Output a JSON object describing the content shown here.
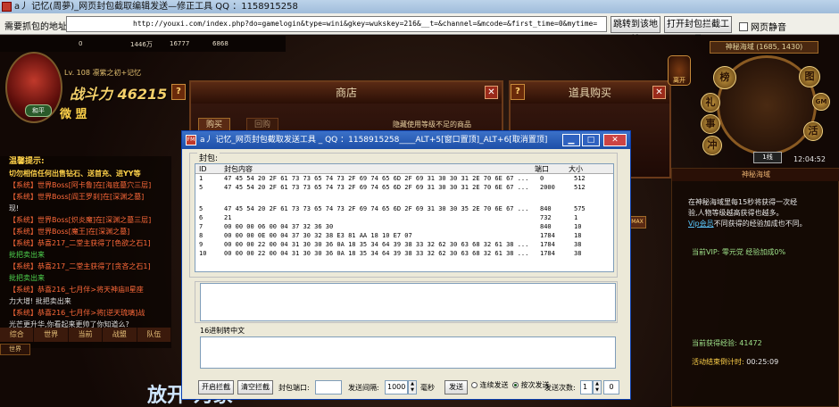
{
  "window": {
    "title": "a丿 记忆(周夢)_网页封包截取编辑发送—修正工具     QQ ：1158915258"
  },
  "urlbar": {
    "label": "需要抓包的地址:",
    "url": "http://youxi.com/index.php?do=gamelogin&type=wini&gkey=wukskey=216&__t=&channel=&mcode=&first_time=0&mytime=",
    "jump_label": "跳转到该地址",
    "open_tool_label": "打开封包拦截工具",
    "mute_label": "网页静音"
  },
  "game": {
    "stats": [
      "0",
      "1446万",
      "16777",
      "6868"
    ],
    "level": "Lv. 108  凛紫之初+记忆",
    "power": "战斗力 46215",
    "peace": "和平",
    "guild": "微 盟",
    "chat_tip": "温馨提示:",
    "chat_lines": [
      "切勿相信任何出售钻石、送首充、进YY等",
      "【系统】世界Boss[阿卡鲁]在[海底墓穴三层]",
      "【系统】世界Boss[阎王罗刹]在[深渊之墓]",
      "现!",
      "【系统】世界Boss[炽炎魔]在[深渊之墓三层]",
      "【系统】世界Boss[魔王]在[深渊之墓]",
      "【系统】恭喜217_二堂主获得了[色欲之石1]",
      "批把卖出来",
      "【系统】恭喜217_二堂主获得了[贪吝之石1]",
      "批把卖出来",
      "【系统】恭喜216_七月伴>将天神庙II星座",
      "力大增!  批把卖出来",
      "【系统】恭喜216_七月伴>将[逆天琉璃]战",
      "光芒更升华,你看起来更帅了你知道么?"
    ],
    "chat_tabs": [
      "综合",
      "世界",
      "当前",
      "战盟",
      "队伍"
    ],
    "world_btn": "世界",
    "big_text": "放开  为家",
    "shop_title": "商店",
    "shop_tab_buy": "购买",
    "shop_tab_buyback": "回购",
    "shop_hide_hint": "隐藏使用等级不足的商品",
    "item_title": "道具购买",
    "map_title": "神秘海域 (1685, 1430)",
    "clock": "12:04:52",
    "line": "1线",
    "leave": "离开",
    "map_buttons": [
      "榜",
      "图",
      "GM",
      "礼",
      "事",
      "冲",
      "活"
    ],
    "side_panel": {
      "title": "神秘海域",
      "desc1": "在神秘海域里每15秒将获得一次经",
      "desc2": "验,人物等级越高获得也越多。",
      "vip_link": "Vip会员",
      "desc3": "不同获得的经验加成也不同。",
      "vip_text": "当前VIP: 零元党  经验加成0%",
      "exp_text": "当前获得经验: 41472",
      "time_label": "活动结束倒计时:",
      "time_value": "00:25:09",
      "side_btn": "MAX"
    }
  },
  "tool": {
    "title": "a丿 记忆_网页封包截取发送工具 _ QQ ：1158915258____ALT+5[窗口置顶]_ALT+6[取消置顶]",
    "packet_group": "封包:",
    "columns": [
      "ID",
      "封包内容",
      "端口",
      "大小"
    ],
    "rows": [
      {
        "id": "1",
        "content": "47 45 54 20 2F 61 73 73 65 74 73 2F 69 74 65 6D 2F 69 31 30 30 31 2E 70 6E 67 ...",
        "port": "0",
        "size": "512"
      },
      {
        "id": "5",
        "content": "47 45 54 20 2F 61 73 73 65 74 73 2F 69 74 65 6D 2F 69 31 30 30 31 2E 70 6E 67 ...",
        "port": "2000",
        "size": "512"
      },
      {
        "id": "",
        "content": "",
        "port": "",
        "size": ""
      },
      {
        "id": "5",
        "content": "47 45 54 20 2F 61 73 73 65 74 73 2F 69 74 65 6D 2F 69 31 30 30 35 2E 70 6E 67 ...",
        "port": "840",
        "size": "575"
      },
      {
        "id": "6",
        "content": "21",
        "port": "732",
        "size": "1"
      },
      {
        "id": "7",
        "content": "00 00 00 06 00 04 37 32 36 30",
        "port": "840",
        "size": "10"
      },
      {
        "id": "8",
        "content": "00 00 00 0E 00 04 37 30 32 38 E3 81 AA 18 10 E7 07",
        "port": "1784",
        "size": "18"
      },
      {
        "id": "9",
        "content": "00 00 00 22 00 04 31 30 30 36 0A 18 35 34 64 39 38 33 32 62 30 63 68 32 61 38 ...",
        "port": "1784",
        "size": "38"
      },
      {
        "id": "10",
        "content": "00 00 00 22 00 04 31 30 30 36 0A 18 35 34 64 39 38 33 32 62 30 63 68 32 61 38 ...",
        "port": "1784",
        "size": "38"
      }
    ],
    "hex_label": "16进制转中文",
    "buttons": {
      "start": "开启拦截",
      "clear": "清空拦截",
      "port_label": "封包端口:",
      "port_value": "",
      "interval_label": "发送间隔:",
      "interval_value": "1000",
      "ms": "毫秒",
      "send": "发送",
      "continuous": "连续发送",
      "times_mode": "按次发送",
      "times_label": "发送次数:",
      "times_value": "1",
      "counter": "0"
    }
  }
}
